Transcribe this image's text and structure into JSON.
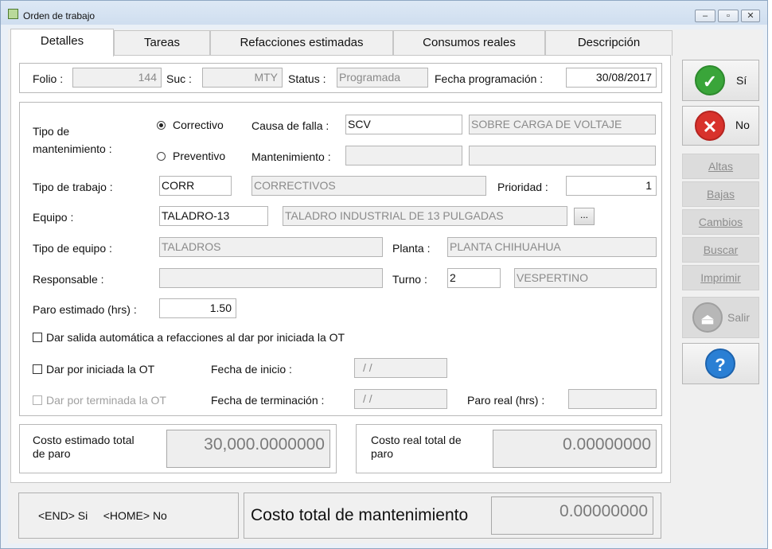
{
  "window": {
    "title": "Orden de trabajo",
    "minimize": "–",
    "maximize": "▫",
    "close": "✕"
  },
  "tabs": [
    "Detalles",
    "Tareas",
    "Refacciones estimadas",
    "Consumos reales",
    "Descripción"
  ],
  "header": {
    "folio_label": "Folio :",
    "folio": "144",
    "suc_label": "Suc :",
    "suc": "MTY",
    "status_label": "Status :",
    "status": "Programada",
    "fecha_prog_label": "Fecha programación :",
    "fecha_prog": "30/08/2017"
  },
  "form": {
    "tipo_mant_label": "Tipo de mantenimiento :",
    "correctivo": "Correctivo",
    "preventivo": "Preventivo",
    "causa_label": "Causa de falla :",
    "causa_code": "SCV",
    "causa_desc": "SOBRE CARGA DE VOLTAJE",
    "mant_label": "Mantenimiento :",
    "mant_code": "",
    "mant_desc": "",
    "tipo_trabajo_label": "Tipo de trabajo :",
    "tipo_trabajo_code": "CORR",
    "tipo_trabajo_desc": "CORRECTIVOS",
    "prioridad_label": "Prioridad :",
    "prioridad": "1",
    "equipo_label": "Equipo :",
    "equipo_code": "TALADRO-13",
    "equipo_desc": "TALADRO INDUSTRIAL DE 13 PULGADAS",
    "browse": "...",
    "tipo_equipo_label": "Tipo de equipo :",
    "tipo_equipo": "TALADROS",
    "planta_label": "Planta :",
    "planta": "PLANTA CHIHUAHUA",
    "responsable_label": "Responsable :",
    "responsable": "",
    "turno_label": "Turno :",
    "turno_code": "2",
    "turno_desc": "VESPERTINO",
    "paro_est_label": "Paro estimado (hrs) :",
    "paro_est": "1.50",
    "salida_auto": "Dar salida automática a refacciones al dar por iniciada la OT",
    "iniciada": "Dar por iniciada la OT",
    "fecha_inicio_label": "Fecha de inicio :",
    "fecha_inicio": "/ /",
    "terminada": "Dar por terminada la OT",
    "fecha_term_label": "Fecha de terminación :",
    "fecha_term": "/ /",
    "paro_real_label": "Paro real (hrs) :",
    "paro_real": ""
  },
  "costs": {
    "est_label": "Costo estimado total de paro",
    "est_value": "30,000.0000000",
    "real_label": "Costo real total de paro",
    "real_value": "0.00000000"
  },
  "footer": {
    "keys": "<END> Si     <HOME> No",
    "total_label": "Costo total de mantenimiento",
    "total_value": "0.00000000"
  },
  "sidebar": {
    "si": "Sí",
    "no": "No",
    "altas": "Altas",
    "bajas": "Bajas",
    "cambios": "Cambios",
    "buscar": "Buscar",
    "imprimir": "Imprimir",
    "salir": "Salir",
    "help": "?"
  },
  "colors": {
    "green_icon": "#3aa53a",
    "red_icon": "#d8322c",
    "blue_icon": "#2a7fd4",
    "gray_icon": "#b7b7b7"
  }
}
